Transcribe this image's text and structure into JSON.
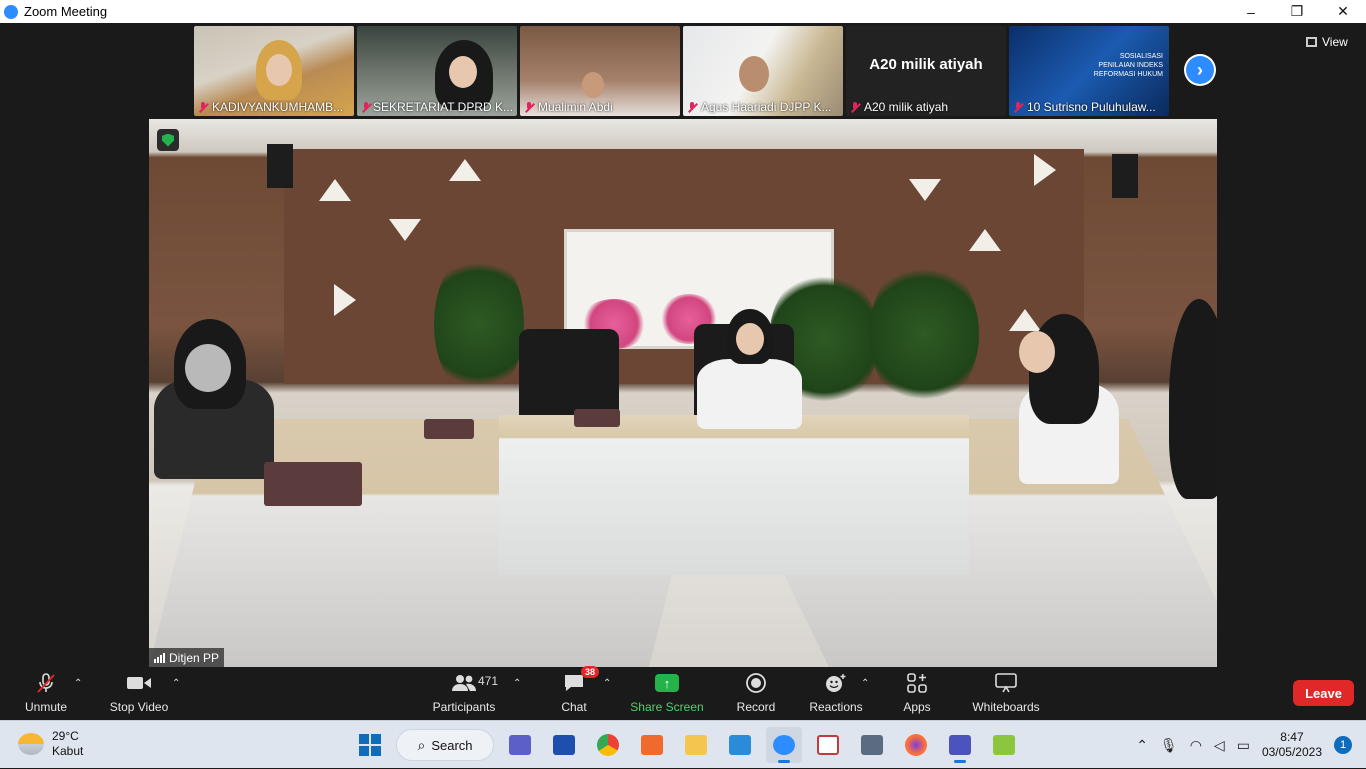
{
  "window": {
    "title": "Zoom Meeting",
    "controls": [
      "–",
      "❐",
      "✕"
    ]
  },
  "view_button": {
    "label": "View"
  },
  "thumbnails": [
    {
      "name": "KADIVYANKUMHAMB..."
    },
    {
      "name": "SEKRETARIAT DPRD K..."
    },
    {
      "name": "Mualimin Abdi"
    },
    {
      "name": "Agus Haariadi DJPP K..."
    },
    {
      "name": "A20 milik atiyah",
      "display_text": "A20 milik atiyah"
    },
    {
      "name": "10 Sutrisno Puluhulaw...",
      "slide_title": "SOSIALISASI PENILAIAN INDEKS REFORMASI HUKUM"
    }
  ],
  "next_page": {
    "icon": "chevron-right-icon",
    "glyph": "›"
  },
  "main_video": {
    "speaker_name": "Ditjen PP"
  },
  "toolbar": {
    "unmute": "Unmute",
    "stop_video": "Stop Video",
    "participants": "Participants",
    "participants_count": "471",
    "chat": "Chat",
    "chat_badge": "38",
    "share_screen": "Share Screen",
    "record": "Record",
    "reactions": "Reactions",
    "apps": "Apps",
    "whiteboards": "Whiteboards",
    "leave": "Leave"
  },
  "taskbar": {
    "weather_temp": "29°C",
    "weather_desc": "Kabut",
    "search_label": "Search",
    "time": "8:47",
    "date": "03/05/2023",
    "notifications": "1"
  },
  "colors": {
    "zoom_blue": "#2d8cff",
    "leave_red": "#e02828",
    "share_green": "#23b34a",
    "toolbar_bg": "#1a1a1a",
    "taskbar_bg": "#dfe5ee"
  }
}
